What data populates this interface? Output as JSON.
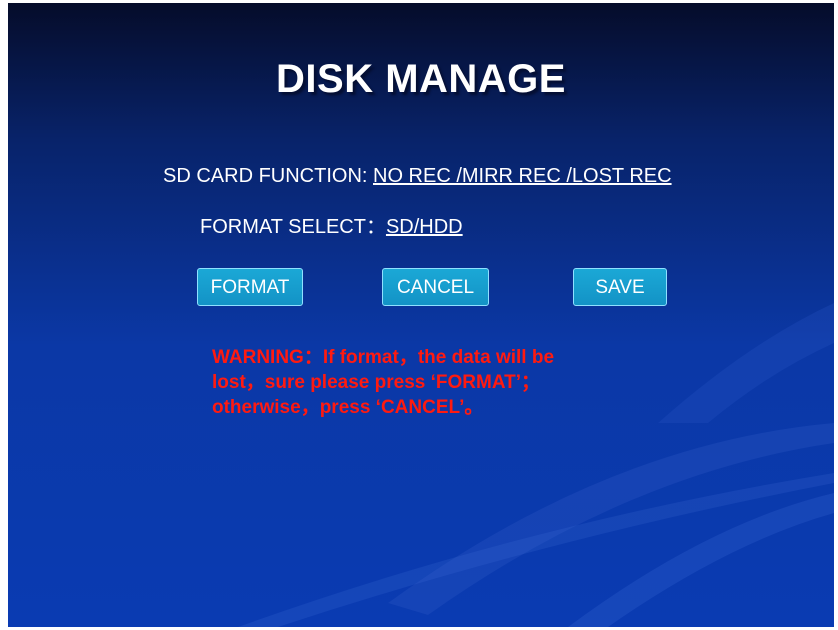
{
  "title": "DISK MANAGE",
  "sd_card_function": {
    "label": "SD CARD FUNCTION: ",
    "value": "NO REC /MIRR REC /LOST REC"
  },
  "format_select": {
    "label": "FORMAT SELECT：",
    "value": "SD/HDD"
  },
  "buttons": {
    "format": "FORMAT",
    "cancel": "CANCEL",
    "save": "SAVE"
  },
  "warning": {
    "line1": "WARNING：If format，the data will be",
    "line2": "lost，sure please press ‘FORMAT’；",
    "line3": "otherwise，press ‘CANCEL’。"
  },
  "colors": {
    "background_top": "#050c2a",
    "background_bottom": "#0a3bb2",
    "button": "#1393c6",
    "warning": "#ff1a10",
    "text": "#ffffff"
  }
}
